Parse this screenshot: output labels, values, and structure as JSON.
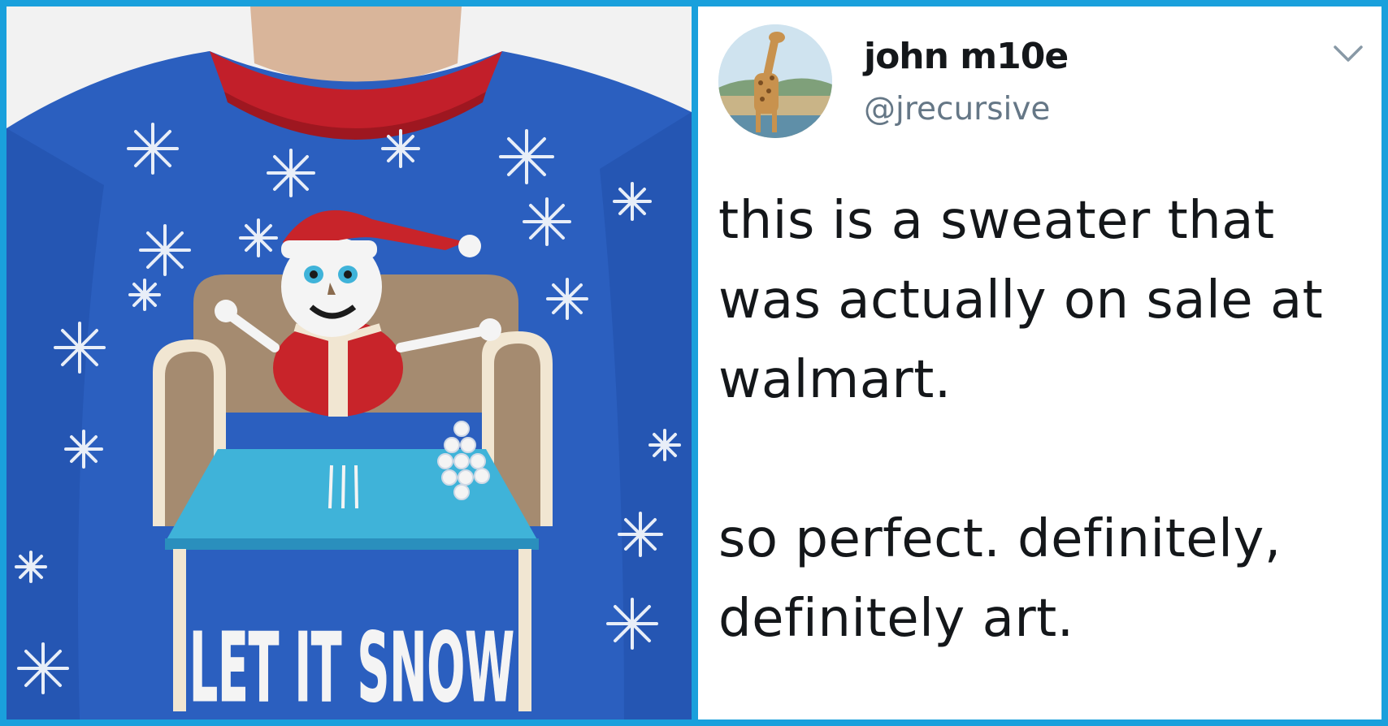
{
  "photo": {
    "sweater_text": "LET IT SNOW",
    "colors": {
      "sweater": "#2b5fbf",
      "collar": "#c21f2a",
      "skin": "#d9b59a",
      "couch": "#a58b70",
      "table": "#3fb3d9",
      "hat": "#c8242a",
      "snowflake": "#e8eef8"
    }
  },
  "tweet": {
    "author_name": "john m10e",
    "author_handle": "@jrecursive",
    "avatar_icon": "giraffe-avatar",
    "menu_icon": "chevron-down-icon",
    "text": "this is a sweater that\nwas actually on sale at\nwalmart.\n\nso perfect.  definitely,\ndefinitely art.",
    "colors": {
      "name": "#14171a",
      "handle": "#657786",
      "text": "#14171a"
    }
  },
  "frame": {
    "border_color": "#1aa0dc"
  }
}
